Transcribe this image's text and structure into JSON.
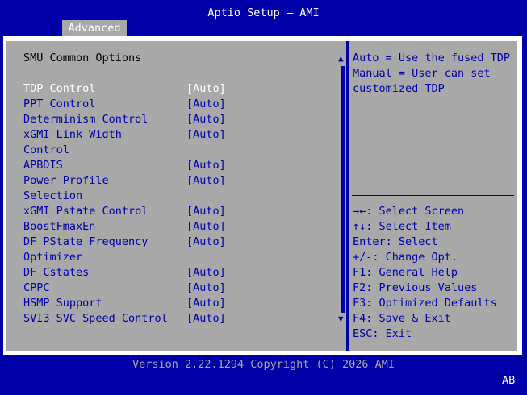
{
  "window": {
    "title": "Aptio Setup – AMI"
  },
  "tabs": [
    {
      "label": "Advanced"
    }
  ],
  "section_title": "SMU Common Options",
  "settings": [
    {
      "label": "TDP Control",
      "value": "[Auto]"
    },
    {
      "label": "PPT Control",
      "value": "[Auto]"
    },
    {
      "label": "Determinism Control",
      "value": "[Auto]"
    },
    {
      "label": "xGMI Link Width",
      "value": "[Auto]"
    },
    {
      "label": "Control",
      "value": ""
    },
    {
      "label": "APBDIS",
      "value": "[Auto]"
    },
    {
      "label": "Power Profile",
      "value": "[Auto]"
    },
    {
      "label": "Selection",
      "value": ""
    },
    {
      "label": "xGMI Pstate Control",
      "value": "[Auto]"
    },
    {
      "label": "BoostFmaxEn",
      "value": "[Auto]"
    },
    {
      "label": "DF PState Frequency",
      "value": "[Auto]"
    },
    {
      "label": "Optimizer",
      "value": ""
    },
    {
      "label": "DF Cstates",
      "value": "[Auto]"
    },
    {
      "label": "CPPC",
      "value": "[Auto]"
    },
    {
      "label": "HSMP Support",
      "value": "[Auto]"
    },
    {
      "label": "SVI3 SVC Speed Control",
      "value": "[Auto]"
    }
  ],
  "help_text": [
    "Auto = Use the fused TDP",
    "Manual = User can set",
    "customized TDP"
  ],
  "key_help": [
    "→←: Select Screen",
    "↑↓: Select Item",
    "Enter: Select",
    "+/-: Change Opt.",
    "F1: General Help",
    "F2: Previous Values",
    "F3: Optimized Defaults",
    "F4: Save & Exit",
    "ESC: Exit"
  ],
  "scroll": {
    "up": "▲",
    "down": "▼"
  },
  "footer": {
    "version": "Version 2.22.1294 Copyright (C) 2026 AMI"
  },
  "badge": "AB",
  "colors": {
    "background": "#0000a8",
    "panel": "#a8a8a8",
    "highlight": "#ffffff"
  }
}
